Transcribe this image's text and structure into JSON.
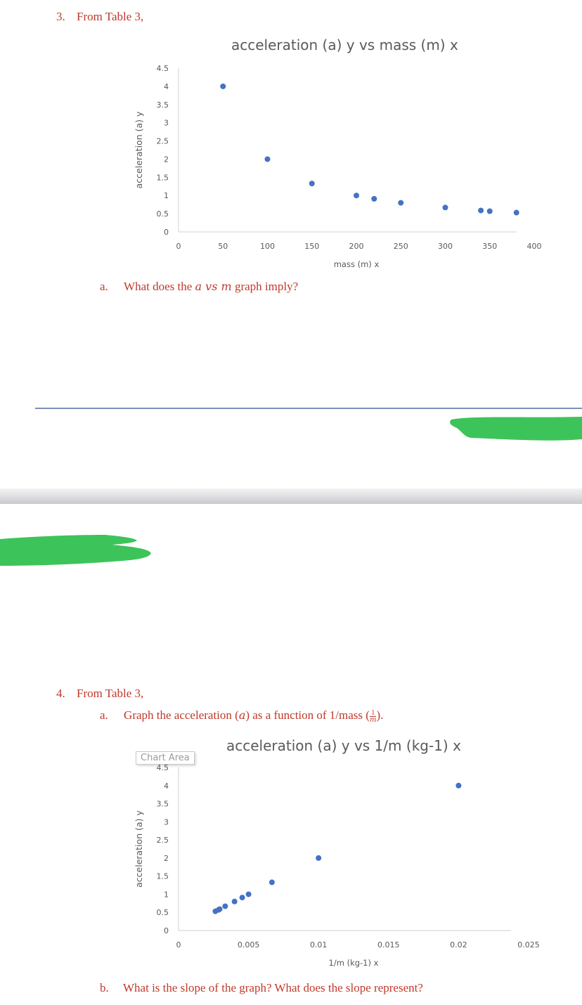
{
  "q3": {
    "heading_number": "3.",
    "heading_text": "From Table 3,",
    "part_a_label": "a.",
    "part_a_pre": "What does the ",
    "part_a_math": "a vs m",
    "part_a_post": " graph imply?"
  },
  "q4": {
    "heading_number": "4.",
    "heading_text": "From Table 3,",
    "part_a_label": "a.",
    "part_a_pre": "Graph the acceleration (",
    "part_a_math": "a",
    "part_a_mid": ") as a function of 1/mass (",
    "part_a_frac_num": "1",
    "part_a_frac_den": "m",
    "part_a_post": ").",
    "part_b_label": "b.",
    "part_b_text": "What is the slope of the graph? What does the slope represent?"
  },
  "chart_area_tooltip": "Chart Area",
  "colors": {
    "text_red": "#c0392b",
    "point_blue": "#4472c4",
    "axis_gray": "#d9d9d9",
    "scribble_green": "#3cc45a",
    "rule_blue": "#7a8fb8"
  },
  "chart_data": [
    {
      "type": "scatter",
      "title": "acceleration (a) y vs mass (m) x",
      "xlabel": "mass (m) x",
      "ylabel": "acceleration (a) y",
      "xlim": [
        0,
        400
      ],
      "ylim": [
        0,
        4.5
      ],
      "xticks": [
        "0",
        "50",
        "100",
        "150",
        "200",
        "250",
        "300",
        "350",
        "400"
      ],
      "yticks": [
        "0",
        "0.5",
        "1",
        "1.5",
        "2",
        "2.5",
        "3",
        "3.5",
        "4",
        "4.5"
      ],
      "grid": false,
      "legend": "none",
      "points": [
        {
          "x": 50,
          "y": 4.0
        },
        {
          "x": 100,
          "y": 2.0
        },
        {
          "x": 150,
          "y": 1.33
        },
        {
          "x": 200,
          "y": 1.0
        },
        {
          "x": 220,
          "y": 0.91
        },
        {
          "x": 250,
          "y": 0.8
        },
        {
          "x": 300,
          "y": 0.67
        },
        {
          "x": 340,
          "y": 0.59
        },
        {
          "x": 350,
          "y": 0.57
        },
        {
          "x": 380,
          "y": 0.53
        }
      ]
    },
    {
      "type": "scatter",
      "title": "acceleration (a) y vs 1/m (kg-1) x",
      "xlabel": "1/m (kg-1) x",
      "ylabel": "acceleration (a) y",
      "xlim": [
        0,
        0.025
      ],
      "ylim": [
        0,
        4.5
      ],
      "xticks": [
        "0",
        "0.005",
        "0.01",
        "0.015",
        "0.02",
        "0.025"
      ],
      "yticks": [
        "0",
        "0.5",
        "1",
        "1.5",
        "2",
        "2.5",
        "3",
        "3.5",
        "4",
        "4.5"
      ],
      "grid": false,
      "legend": "none",
      "points": [
        {
          "x": 0.02,
          "y": 4.0
        },
        {
          "x": 0.01,
          "y": 2.0
        },
        {
          "x": 0.00667,
          "y": 1.33
        },
        {
          "x": 0.005,
          "y": 1.0
        },
        {
          "x": 0.00455,
          "y": 0.91
        },
        {
          "x": 0.004,
          "y": 0.8
        },
        {
          "x": 0.00333,
          "y": 0.67
        },
        {
          "x": 0.00294,
          "y": 0.59
        },
        {
          "x": 0.00286,
          "y": 0.57
        },
        {
          "x": 0.00263,
          "y": 0.53
        }
      ]
    }
  ]
}
